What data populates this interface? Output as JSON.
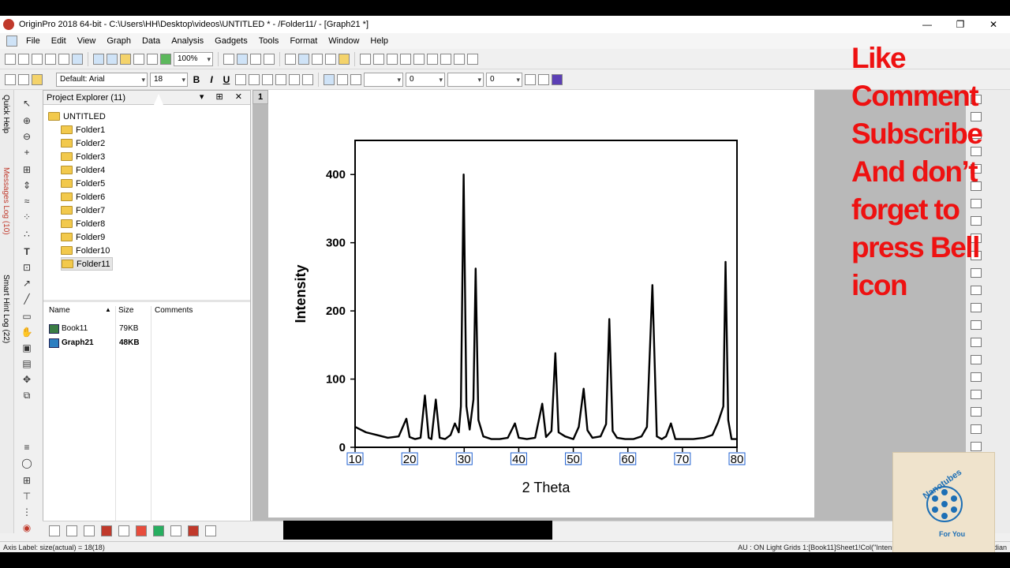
{
  "window": {
    "title": "OriginPro 2018 64-bit - C:\\Users\\HH\\Desktop\\videos\\UNTITLED * - /Folder11/ - [Graph21 *]",
    "minimize": "—",
    "maximize": "❐",
    "close": "✕"
  },
  "menu": [
    "File",
    "Edit",
    "View",
    "Graph",
    "Data",
    "Analysis",
    "Gadgets",
    "Tools",
    "Format",
    "Window",
    "Help"
  ],
  "toolbar": {
    "zoom": "100%",
    "font": "Default: Arial",
    "font_size": "18",
    "bold": "B",
    "italic": "I",
    "underline": "U",
    "field_a": "0",
    "field_b": "0"
  },
  "left_tabs": [
    "Quick Help",
    "Messages Log (10)",
    "Smart Hint Log (22)"
  ],
  "project_explorer": {
    "title": "Project Explorer (11)",
    "root": "UNTITLED",
    "folders": [
      "Folder1",
      "Folder2",
      "Folder3",
      "Folder4",
      "Folder5",
      "Folder6",
      "Folder7",
      "Folder8",
      "Folder9",
      "Folder10",
      "Folder11"
    ],
    "selected": "Folder11",
    "columns": [
      "Name",
      "Size",
      "Comments"
    ],
    "files": [
      {
        "name": "Book11",
        "size": "79KB",
        "comments": ""
      },
      {
        "name": "Graph21",
        "size": "48KB",
        "comments": ""
      }
    ]
  },
  "graph": {
    "layer_label": "1"
  },
  "chart_data": {
    "type": "line",
    "title": "",
    "xlabel": "2 Theta",
    "ylabel": "Intensity",
    "xlim": [
      10,
      80
    ],
    "ylim": [
      0,
      450
    ],
    "xticks": [
      10,
      20,
      30,
      40,
      50,
      60,
      70,
      80
    ],
    "yticks": [
      0,
      100,
      200,
      300,
      400
    ],
    "grid": false,
    "series": [
      {
        "color": "#000000",
        "x": [
          10,
          12,
          14,
          16,
          18,
          19.4,
          20,
          21,
          22,
          22.8,
          23.5,
          24,
          24.8,
          25.5,
          26.5,
          27.5,
          28.3,
          29,
          29.4,
          29.9,
          30.4,
          31,
          31.7,
          32.1,
          32.6,
          33.5,
          35,
          36.5,
          38,
          39.3,
          40,
          41.5,
          43,
          44.3,
          45,
          46,
          46.7,
          47.3,
          48.5,
          50,
          51,
          51.9,
          52.6,
          53.5,
          55,
          56,
          56.6,
          57.2,
          58,
          59.5,
          61,
          62.5,
          63.5,
          64.5,
          65.3,
          66.2,
          67,
          67.9,
          68.7,
          70,
          72,
          74,
          75.5,
          76.5,
          77.5,
          77.9,
          78.4,
          79,
          80
        ],
        "y": [
          30,
          22,
          18,
          14,
          16,
          42,
          15,
          12,
          14,
          76,
          14,
          12,
          70,
          14,
          12,
          18,
          35,
          22,
          60,
          400,
          60,
          26,
          70,
          262,
          40,
          16,
          12,
          12,
          14,
          35,
          14,
          12,
          14,
          64,
          15,
          24,
          138,
          22,
          16,
          12,
          30,
          86,
          25,
          14,
          16,
          34,
          188,
          24,
          14,
          12,
          12,
          16,
          30,
          238,
          16,
          12,
          16,
          35,
          12,
          12,
          12,
          14,
          18,
          36,
          60,
          272,
          40,
          12,
          12
        ]
      }
    ]
  },
  "overlay": [
    "Like",
    "Comment",
    "Subscribe",
    "And don’t",
    "forget to",
    "press Bell",
    "icon"
  ],
  "badge": {
    "top": "Nanotubes",
    "bottom": "For You"
  },
  "status": {
    "left": "Axis Label: size(actual) = 18(18)",
    "right": "AU : ON  Light Grids  1:[Book11]Sheet1!Col(\"Intensity\")[1:3501]  1:[Graph21]1!1  Radian"
  }
}
